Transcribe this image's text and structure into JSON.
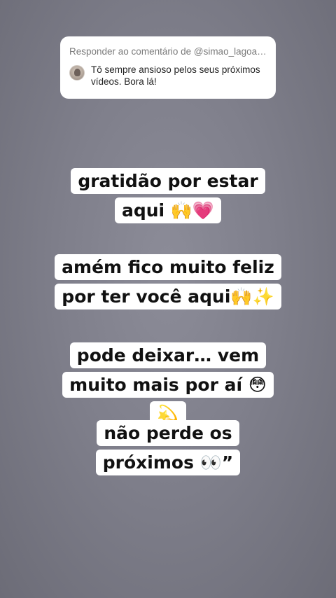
{
  "reply": {
    "header": "Responder ao comentário de @simao_lagoa_...",
    "comment": "Tô sempre ansioso pelos seus próximos vídeos. Bora  lá!"
  },
  "captions": [
    {
      "lines": [
        "gratidão por estar",
        "aqui 🙌💗"
      ]
    },
    {
      "lines": [
        "amém fico muito feliz",
        "por ter você aqui🙌✨"
      ]
    },
    {
      "lines": [
        "pode deixar… vem",
        "muito mais por aí 😳",
        "💫"
      ]
    },
    {
      "lines": [
        "não perde os",
        "próximos 👀”"
      ]
    }
  ]
}
